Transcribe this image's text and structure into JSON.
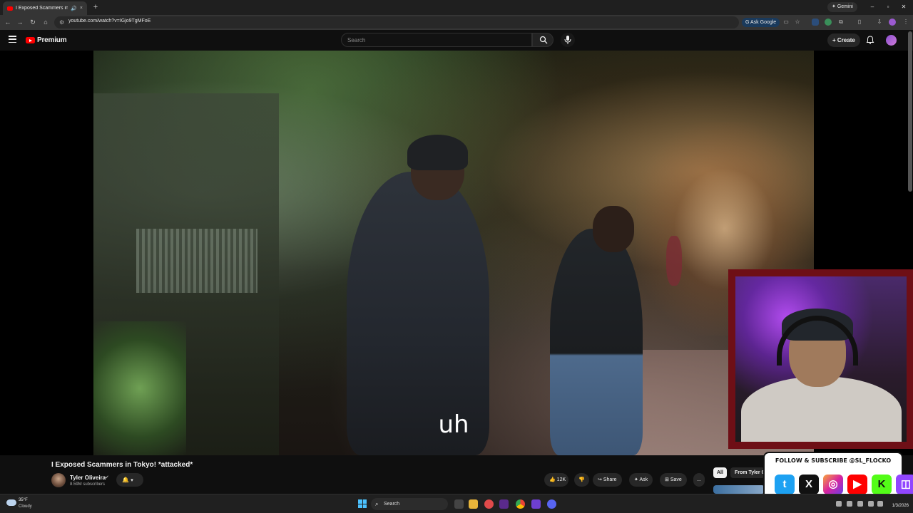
{
  "browser": {
    "tab_title": "I Exposed Scammers in Toky",
    "new_tab_label": "+",
    "gemini_label": "Gemini",
    "url": "youtube.com/watch?v=IGjo9TgMFoE",
    "ask_google_label": "Ask Google"
  },
  "masthead": {
    "logo_text": "Premium",
    "search_placeholder": "Search",
    "create_label": "Create"
  },
  "player": {
    "caption": "uh"
  },
  "video": {
    "title": "I Exposed Scammers in Tokyo! *attacked*",
    "channel_name": "Tyler Oliveira",
    "subscribers": "8.59M subscribers",
    "likes": "12K",
    "share_label": "Share",
    "ask_label": "Ask",
    "save_label": "Save",
    "more_label": "..."
  },
  "sidebar_filters": {
    "all_label": "All",
    "from_label": "From Tyler C"
  },
  "overlay": {
    "follow_text": "FOLLOW & SUBSCRIBE @SL_FLOCKO",
    "socials": [
      "twitter-icon",
      "x-icon",
      "instagram-icon",
      "youtube-icon",
      "kick-icon",
      "twitch-icon"
    ]
  },
  "taskbar": {
    "weather_temp": "35°F",
    "weather_desc": "Cloudy",
    "search_label": "Search",
    "date": "1/3/2026"
  },
  "colors": {
    "youtube_red": "#ff0000",
    "webcam_border": "#6e0f16",
    "background": "#0f0f0f"
  }
}
